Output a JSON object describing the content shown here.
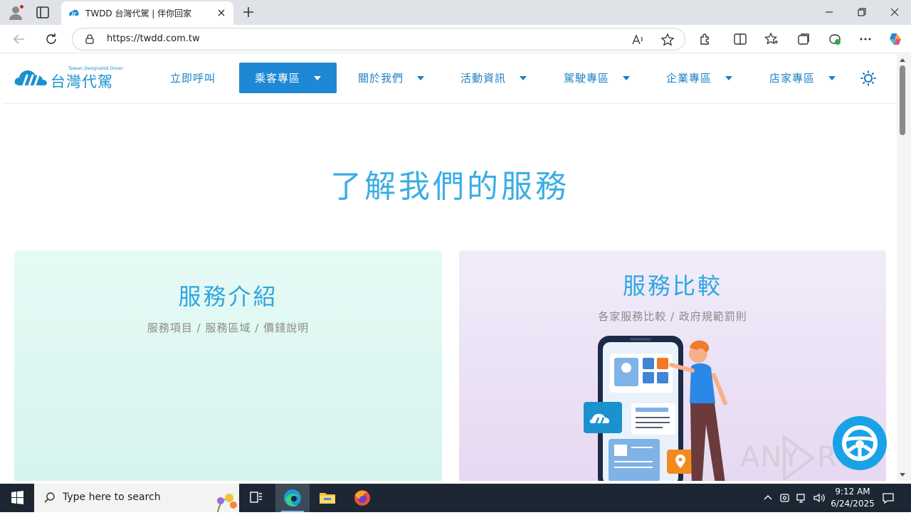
{
  "browser": {
    "tab": {
      "title": "TWDD 台灣代駕 | 伴你回家"
    },
    "url": "https://twdd.com.tw"
  },
  "site": {
    "logo": {
      "name": "台灣代駕",
      "tagline": "Taiwan Designated Driver"
    },
    "menu": [
      {
        "label": "立即呼叫",
        "has_dropdown": false,
        "active": false
      },
      {
        "label": "乘客專區",
        "has_dropdown": true,
        "active": true
      },
      {
        "label": "關於我們",
        "has_dropdown": true,
        "active": false
      },
      {
        "label": "活動資訊",
        "has_dropdown": true,
        "active": false
      },
      {
        "label": "駕駛專區",
        "has_dropdown": true,
        "active": false
      },
      {
        "label": "企業專區",
        "has_dropdown": true,
        "active": false
      },
      {
        "label": "店家專區",
        "has_dropdown": true,
        "active": false
      }
    ],
    "section_title": "了解我們的服務",
    "cards": [
      {
        "title": "服務介紹",
        "subtitle": "服務項目 / 服務區域 / 價錢說明"
      },
      {
        "title": "服務比較",
        "subtitle": "各家服務比較 / 政府規範罰則"
      }
    ],
    "watermark": "ANY RUN"
  },
  "taskbar": {
    "search_placeholder": "Type here to search",
    "time": "9:12 AM",
    "date": "6/24/2025"
  },
  "colors": {
    "brand_blue": "#1b7fc6",
    "active_menu": "#1e88d4",
    "title_blue": "#3aaee5",
    "fab": "#1aa2e6"
  }
}
